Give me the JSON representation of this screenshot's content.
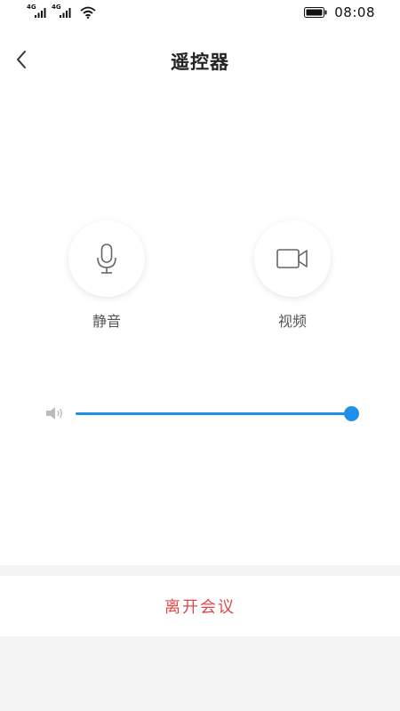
{
  "status_bar": {
    "signal1_label": "4G",
    "signal2_label": "4G",
    "time": "08:08"
  },
  "header": {
    "title": "遥控器",
    "back_icon": "chevron-left-icon"
  },
  "controls": {
    "mute_label": "静音",
    "mute_icon": "microphone-icon",
    "video_label": "视频",
    "video_icon": "video-camera-icon"
  },
  "volume": {
    "icon": "speaker-icon",
    "level": 1.0
  },
  "footer": {
    "leave_label": "离开会议"
  },
  "colors": {
    "accent": "#1e90e8",
    "danger": "#e04848",
    "page_bg": "#ffffff",
    "bottom_bg": "#f4f4f4"
  }
}
